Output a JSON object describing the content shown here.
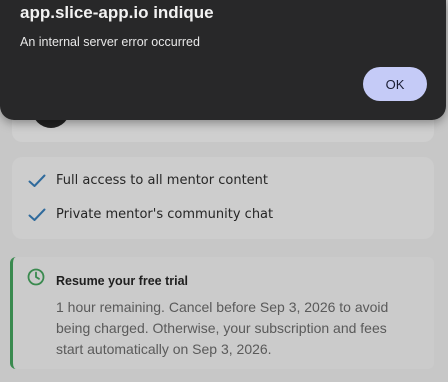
{
  "dialog": {
    "title": "app.slice-app.io indique",
    "message": "An internal server error occurred",
    "ok_label": "OK"
  },
  "features": [
    {
      "label": "Full access to all mentor content",
      "icon": "check-icon"
    },
    {
      "label": "Private mentor's community chat",
      "icon": "check-icon"
    }
  ],
  "trial": {
    "icon": "clock-icon",
    "title": "Resume your free trial",
    "body": "1 hour remaining. Cancel before Sep 3, 2026 to avoid being charged. Otherwise, your subscription and fees start automatically on Sep 3, 2026."
  },
  "colors": {
    "dialog_bg": "#282829",
    "ok_button_bg": "#c5cbf7",
    "check_color": "#2f6a9c",
    "trial_accent": "#3a8a4f"
  }
}
